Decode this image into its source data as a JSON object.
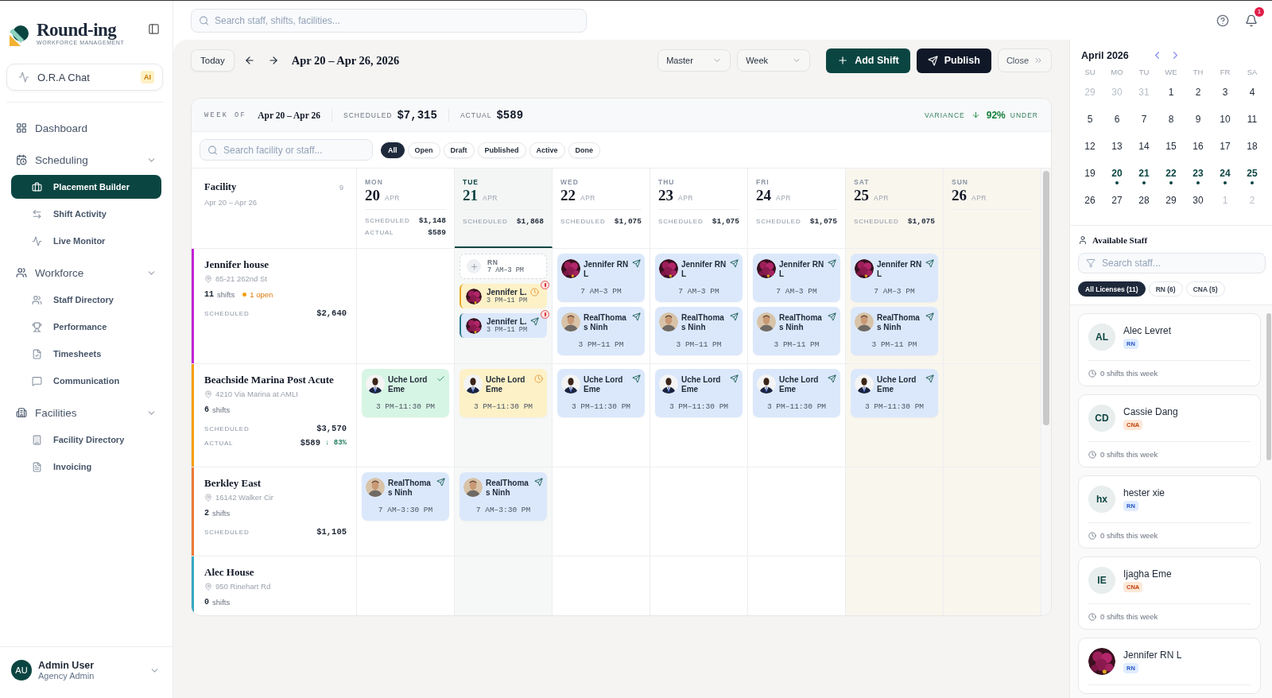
{
  "brand": {
    "name": "Round-ing",
    "subtitle": "WORKFORCE MANAGEMENT"
  },
  "ora_chat": {
    "label": "O.R.A Chat",
    "badge": "AI"
  },
  "nav": [
    {
      "label": "Dashboard",
      "selected": false
    },
    {
      "label": "Scheduling",
      "expanded": true,
      "children": [
        {
          "label": "Placement Builder",
          "selected": true
        },
        {
          "label": "Shift Activity",
          "selected": false
        },
        {
          "label": "Live Monitor",
          "selected": false
        }
      ]
    },
    {
      "label": "Workforce",
      "expanded": true,
      "children": [
        {
          "label": "Staff Directory",
          "selected": false
        },
        {
          "label": "Performance",
          "selected": false
        },
        {
          "label": "Timesheets",
          "selected": false
        },
        {
          "label": "Communication",
          "selected": false
        }
      ]
    },
    {
      "label": "Facilities",
      "expanded": true,
      "children": [
        {
          "label": "Facility Directory",
          "selected": false
        },
        {
          "label": "Invoicing",
          "selected": false
        }
      ]
    }
  ],
  "user": {
    "initials": "AU",
    "name": "Admin User",
    "role": "Agency Admin"
  },
  "topbar": {
    "search_placeholder": "Search staff, shifts, facilities...",
    "notifications": "1"
  },
  "toolbar": {
    "today": "Today",
    "range": "Apr 20 – Apr 26, 2026",
    "selects": [
      "Master",
      "Week"
    ],
    "add_shift": "Add Shift",
    "publish": "Publish",
    "close": "Close"
  },
  "summary": {
    "week_label": "WEEK OF",
    "week_value": "Apr 20 – Apr 26",
    "scheduled_label": "SCHEDULED",
    "scheduled_value": "$7,315",
    "actual_label": "ACTUAL",
    "actual_value": "$589",
    "variance_label": "VARIANCE",
    "variance_value": "92%",
    "variance_suffix": "UNDER"
  },
  "filters": {
    "search_placeholder": "Search facility or staff...",
    "chips": [
      {
        "label": "All",
        "selected": true
      },
      {
        "label": "Open",
        "selected": false
      },
      {
        "label": "Draft",
        "selected": false
      },
      {
        "label": "Published",
        "selected": false
      },
      {
        "label": "Active",
        "selected": false
      },
      {
        "label": "Done",
        "selected": false
      }
    ]
  },
  "facility_header": {
    "title": "Facility",
    "subtitle": "Apr 20 – Apr 26",
    "count": "9"
  },
  "days": [
    {
      "dow": "MON",
      "date": "20",
      "month": "APR",
      "selected": false,
      "weekend": false,
      "stats": [
        {
          "label": "SCHEDULED",
          "value": "$1,148"
        },
        {
          "label": "ACTUAL",
          "value": "$589"
        }
      ]
    },
    {
      "dow": "TUE",
      "date": "21",
      "month": "APR",
      "selected": true,
      "weekend": false,
      "stats": [
        {
          "label": "SCHEDULED",
          "value": "$1,868"
        }
      ]
    },
    {
      "dow": "WED",
      "date": "22",
      "month": "APR",
      "selected": false,
      "weekend": false,
      "stats": [
        {
          "label": "SCHEDULED",
          "value": "$1,075"
        }
      ]
    },
    {
      "dow": "THU",
      "date": "23",
      "month": "APR",
      "selected": false,
      "weekend": false,
      "stats": [
        {
          "label": "SCHEDULED",
          "value": "$1,075"
        }
      ]
    },
    {
      "dow": "FRI",
      "date": "24",
      "month": "APR",
      "selected": false,
      "weekend": false,
      "stats": [
        {
          "label": "SCHEDULED",
          "value": "$1,075"
        }
      ]
    },
    {
      "dow": "SAT",
      "date": "25",
      "month": "APR",
      "selected": false,
      "weekend": true,
      "stats": [
        {
          "label": "SCHEDULED",
          "value": "$1,075"
        }
      ]
    },
    {
      "dow": "SUN",
      "date": "26",
      "month": "APR",
      "selected": false,
      "weekend": true
    }
  ],
  "facilities": [
    {
      "name": "Jennifer house",
      "address": "85-21 262nd St",
      "shifts_count": "11",
      "shifts_label": "shifts",
      "open": "1 open",
      "color": "#c026d3",
      "stats": [
        {
          "label": "SCHEDULED",
          "value": "$2,640"
        }
      ],
      "cells": [
        [],
        [
          {
            "kind": "open",
            "role": "RN",
            "time": "7 AM–3 PM"
          },
          {
            "kind": "compact",
            "name": "Jennifer L.",
            "time": "3 PM–11 PM",
            "confirmed": false,
            "pending": true,
            "alert": true
          },
          {
            "kind": "compact",
            "name": "Jennifer L.",
            "time": "3 PM–11 PM",
            "confirmed": false,
            "pending": false,
            "alert": true
          }
        ],
        [
          {
            "kind": "card",
            "name": "Jennifer RN L",
            "time": "7 AM–3 PM",
            "confirmed": false,
            "pending": false
          },
          {
            "kind": "card",
            "name": "RealThomas Ninh",
            "time": "3 PM–11 PM",
            "confirmed": false,
            "pending": false
          }
        ],
        [
          {
            "kind": "card",
            "name": "Jennifer RN L",
            "time": "7 AM–3 PM",
            "confirmed": false,
            "pending": false
          },
          {
            "kind": "card",
            "name": "RealThomas Ninh",
            "time": "3 PM–11 PM",
            "confirmed": false,
            "pending": false
          }
        ],
        [
          {
            "kind": "card",
            "name": "Jennifer RN L",
            "time": "7 AM–3 PM",
            "confirmed": false,
            "pending": false
          },
          {
            "kind": "card",
            "name": "RealThomas Ninh",
            "time": "3 PM–11 PM",
            "confirmed": false,
            "pending": false
          }
        ],
        [
          {
            "kind": "card",
            "name": "Jennifer RN L",
            "time": "7 AM–3 PM",
            "confirmed": false,
            "pending": false
          },
          {
            "kind": "card",
            "name": "RealThomas Ninh",
            "time": "3 PM–11 PM",
            "confirmed": false,
            "pending": false
          }
        ],
        []
      ]
    },
    {
      "name": "Beachside Marina Post Acute",
      "address": "4210 Via Marina at AMLI",
      "shifts_count": "6",
      "shifts_label": "shifts",
      "color": "#f59e0b",
      "stats": [
        {
          "label": "SCHEDULED",
          "value": "$3,570"
        },
        {
          "label": "ACTUAL",
          "value": "$589",
          "delta": "↓ 83%"
        }
      ],
      "cells": [
        [
          {
            "kind": "card",
            "name": "Uche Lord Eme",
            "time": "3 PM–11:30 PM",
            "confirmed": true,
            "pending": false
          }
        ],
        [
          {
            "kind": "card",
            "name": "Uche Lord Eme",
            "time": "3 PM–11:30 PM",
            "confirmed": false,
            "pending": true
          }
        ],
        [
          {
            "kind": "card",
            "name": "Uche Lord Eme",
            "time": "3 PM–11:30 PM",
            "confirmed": false,
            "pending": false
          }
        ],
        [
          {
            "kind": "card",
            "name": "Uche Lord Eme",
            "time": "3 PM–11:30 PM",
            "confirmed": false,
            "pending": false
          }
        ],
        [
          {
            "kind": "card",
            "name": "Uche Lord Eme",
            "time": "3 PM–11:30 PM",
            "confirmed": false,
            "pending": false
          }
        ],
        [
          {
            "kind": "card",
            "name": "Uche Lord Eme",
            "time": "3 PM–11:30 PM",
            "confirmed": false,
            "pending": false
          }
        ],
        []
      ]
    },
    {
      "name": "Berkley East",
      "address": "16142 Walker Cir",
      "shifts_count": "2",
      "shifts_label": "shifts",
      "color": "#ea7a3a",
      "stats": [
        {
          "label": "SCHEDULED",
          "value": "$1,105"
        }
      ],
      "cells": [
        [
          {
            "kind": "card",
            "name": "RealThomas Ninh",
            "time": "7 AM–3:30 PM",
            "confirmed": false,
            "pending": false
          }
        ],
        [
          {
            "kind": "card",
            "name": "RealThomas Ninh",
            "time": "7 AM–3:30 PM",
            "confirmed": false,
            "pending": false
          }
        ],
        [],
        [],
        [],
        [],
        []
      ]
    },
    {
      "name": "Alec House",
      "address": "950 Rinehart Rd",
      "shifts_count": "0",
      "shifts_label": "shifts",
      "color": "#3aa6c4",
      "cells": [
        [],
        [],
        [],
        [],
        [],
        [],
        []
      ]
    }
  ],
  "calendar": {
    "month": "April 2026",
    "weekdays": [
      "SU",
      "MO",
      "TU",
      "WE",
      "TH",
      "FR",
      "SA"
    ],
    "days": [
      {
        "label": "29",
        "muted": true,
        "marked": false
      },
      {
        "label": "30",
        "muted": true,
        "marked": false
      },
      {
        "label": "31",
        "muted": true,
        "marked": false
      },
      {
        "label": "1",
        "muted": false,
        "marked": false
      },
      {
        "label": "2",
        "muted": false,
        "marked": false
      },
      {
        "label": "3",
        "muted": false,
        "marked": false
      },
      {
        "label": "4",
        "muted": false,
        "marked": false
      },
      {
        "label": "5",
        "muted": false,
        "marked": false
      },
      {
        "label": "6",
        "muted": false,
        "marked": false
      },
      {
        "label": "7",
        "muted": false,
        "marked": false
      },
      {
        "label": "8",
        "muted": false,
        "marked": false
      },
      {
        "label": "9",
        "muted": false,
        "marked": false
      },
      {
        "label": "10",
        "muted": false,
        "marked": false
      },
      {
        "label": "11",
        "muted": false,
        "marked": false
      },
      {
        "label": "12",
        "muted": false,
        "marked": false
      },
      {
        "label": "13",
        "muted": false,
        "marked": false
      },
      {
        "label": "14",
        "muted": false,
        "marked": false
      },
      {
        "label": "15",
        "muted": false,
        "marked": false
      },
      {
        "label": "16",
        "muted": false,
        "marked": false
      },
      {
        "label": "17",
        "muted": false,
        "marked": false
      },
      {
        "label": "18",
        "muted": false,
        "marked": false
      },
      {
        "label": "19",
        "muted": false,
        "marked": false
      },
      {
        "label": "20",
        "muted": false,
        "marked": true
      },
      {
        "label": "21",
        "muted": false,
        "marked": true
      },
      {
        "label": "22",
        "muted": false,
        "marked": true
      },
      {
        "label": "23",
        "muted": false,
        "marked": true
      },
      {
        "label": "24",
        "muted": false,
        "marked": true
      },
      {
        "label": "25",
        "muted": false,
        "marked": true
      },
      {
        "label": "26",
        "muted": false,
        "marked": false
      },
      {
        "label": "27",
        "muted": false,
        "marked": false
      },
      {
        "label": "28",
        "muted": false,
        "marked": false
      },
      {
        "label": "29",
        "muted": false,
        "marked": false
      },
      {
        "label": "30",
        "muted": false,
        "marked": false
      },
      {
        "label": "1",
        "muted": true,
        "marked": false
      },
      {
        "label": "2",
        "muted": true,
        "marked": false
      }
    ]
  },
  "staff": {
    "title": "Available Staff",
    "search_placeholder": "Search staff...",
    "chips": [
      {
        "label": "All Licenses (11)",
        "selected": true
      },
      {
        "label": "RN (6)",
        "selected": false
      },
      {
        "label": "CNA (5)",
        "selected": false
      }
    ],
    "list": [
      {
        "kind": "initials",
        "initials": "AL",
        "name": "Alec Levret",
        "license": {
          "label": "RN",
          "kind": "rn"
        },
        "shifts": "0 shifts this week"
      },
      {
        "kind": "initials",
        "initials": "CD",
        "name": "Cassie Dang",
        "license": {
          "label": "CNA",
          "kind": "cna"
        },
        "shifts": "0 shifts this week"
      },
      {
        "kind": "initials",
        "initials": "hx",
        "name": "hester xie",
        "license": {
          "label": "RN",
          "kind": "rn"
        },
        "shifts": "0 shifts this week"
      },
      {
        "kind": "initials",
        "initials": "IE",
        "name": "Ijagha Eme",
        "license": {
          "label": "CNA",
          "kind": "cna"
        },
        "shifts": "0 shifts this week"
      },
      {
        "kind": "picture",
        "name": "Jennifer RN L",
        "license": {
          "label": "RN",
          "kind": "rn"
        }
      }
    ]
  }
}
